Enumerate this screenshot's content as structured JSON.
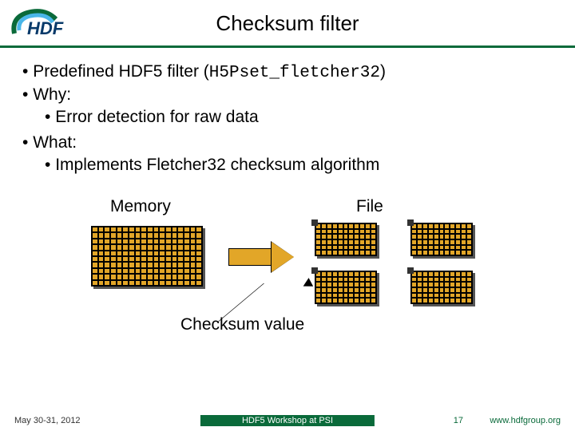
{
  "title": "Checksum filter",
  "bullets": {
    "b1a_prefix": "Predefined HDF5 filter (",
    "b1a_code": "H5Pset_fletcher32",
    "b1a_suffix": ")",
    "b1b": "Why:",
    "b2a": "Error detection for raw data",
    "b1c": "What:",
    "b2b": "Implements Fletcher32 checksum algorithm"
  },
  "diagram": {
    "memory": "Memory",
    "file": "File",
    "checksum": "Checksum value"
  },
  "footer": {
    "date": "May 30-31, 2012",
    "event": "HDF5 Workshop at PSI",
    "page": "17",
    "url": "www.hdfgroup.org"
  }
}
